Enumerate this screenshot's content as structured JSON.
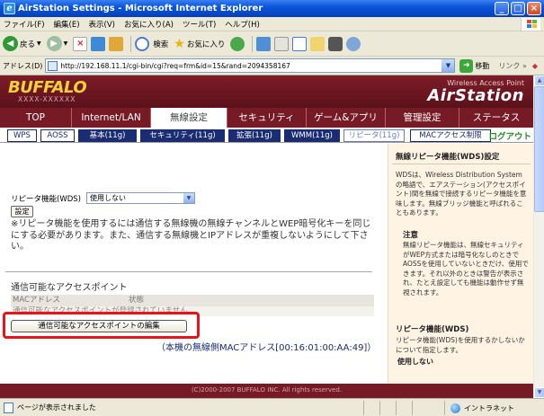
{
  "window": {
    "title": "AirStation Settings - Microsoft Internet Explorer"
  },
  "menubar": [
    "ファイル(F)",
    "編集(E)",
    "表示(V)",
    "お気に入り(A)",
    "ツール(T)",
    "ヘルプ(H)"
  ],
  "toolbar": {
    "back": "戻る",
    "search": "検索",
    "favorites": "お気に入り"
  },
  "address": {
    "label": "アドレス(D)",
    "url": "http://192.168.11.1/cgi-bin/cgi?req=frm&id=15&rand=2094358167",
    "go": "移動",
    "links": "リンク »"
  },
  "banner": {
    "logo": "BUFFALO",
    "model": "XXXX-XXXXXX",
    "product_line": "Wireless Access Point",
    "product": "AirStation"
  },
  "nav_tabs": [
    "TOP",
    "Internet/LAN",
    "無線設定",
    "セキュリティ",
    "ゲーム&アプリ",
    "管理設定",
    "ステータス"
  ],
  "nav_active": "無線設定",
  "sub_tabs": [
    "WPS",
    "AOSS",
    "基本(11g)",
    "セキュリティ(11g)",
    "拡張(11g)",
    "WMM(11g)",
    "リピータ(11g)",
    "MACアクセス制限"
  ],
  "logout": "ログアウト",
  "main": {
    "repeater_label": "リピータ機能(WDS)",
    "repeater_value": "使用しない",
    "set_button": "設定",
    "note": "※リピータ機能を使用するには通信する無線機の無線チャンネルとWEP暗号化キーを同じにする必要があります。また、通信する無線機とIPアドレスが重複しないようにして下さい。",
    "ap_title": "通信可能なアクセスポイント",
    "ap_col_mac": "MACアドレス",
    "ap_col_status": "状態",
    "ap_empty": "通信可能なアクセスポイントが登録されていません",
    "edit_button": "通信可能なアクセスポイントの編集",
    "mac_line": "（本機の無線側MACアドレス[00:16:01:00:AA:49]）"
  },
  "sidebar": {
    "title": "無線リピータ機能(WDS)設定",
    "intro": "WDSは、Wireless Distribution System の略語で、エアステーション(アクセスポイント)間を無線で接続するリピータ機能を意味します。無線ブリッジ機能と呼ばれることもあります。",
    "caution_title": "注意",
    "caution_text": "無線リピータ機能は、無線セキュリティがWEP方式または暗号化なしのときでAOSSを使用していないときだけ、使用できます。それ以外のときは警告が表示され、たとえ設定しても機能は動作せず無視されます。",
    "section_title": "リピータ機能(WDS)",
    "section_text": "リピータ機能(WDS)を使用するかしないかについて指定します。",
    "section_sub": "使用しない"
  },
  "footer": "(C)2000-2007 BUFFALO INC. All rights reserved.",
  "statusbar": {
    "text": "ページが表示されました",
    "zone": "イントラネット"
  },
  "colors": {
    "banner": "#761a25",
    "highlight": "#e8141c",
    "subtab_dark": "#1a2c72",
    "logout": "#2a8a2a"
  }
}
